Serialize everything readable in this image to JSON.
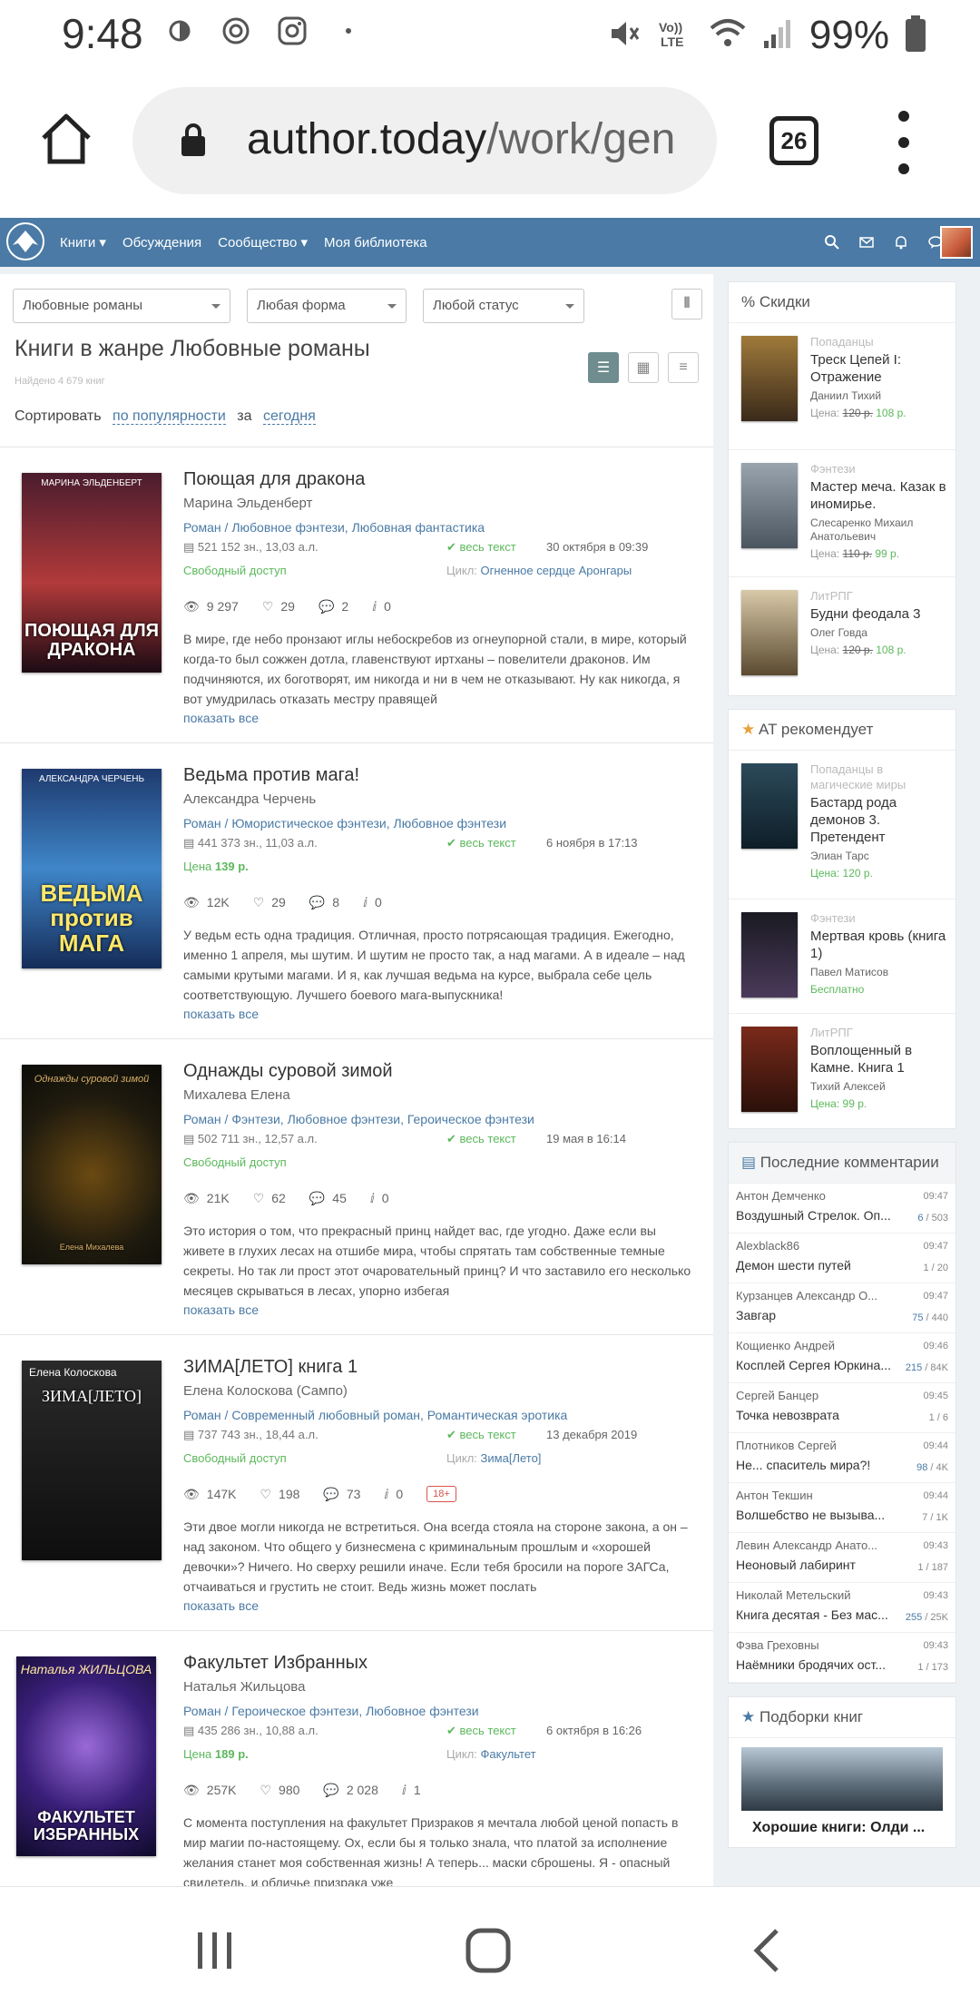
{
  "status": {
    "time": "9:48",
    "battery": "99%"
  },
  "browser": {
    "url_host": "author.today",
    "url_path": "/work/gen",
    "tab_count": "26"
  },
  "nav": {
    "links": [
      "Книги",
      "Обсуждения",
      "Сообщество",
      "Моя библиотека"
    ]
  },
  "filters": {
    "genre": "Любовные романы",
    "form": "Любая форма",
    "status": "Любой статус"
  },
  "page": {
    "title": "Книги в жанре Любовные романы",
    "found": "Найдено 4 679 книг",
    "sort_label": "Сортировать",
    "sort_value": "по популярности",
    "period_label": "за",
    "period_value": "сегодня"
  },
  "books": [
    {
      "title": "Поющая для дракона",
      "author": "Марина Эльденберт",
      "genres": "Роман / Любовное фэнтези, Любовная фантастика",
      "size": "521 152 зн., 13,03 а.л.",
      "text_status": "весь текст",
      "date": "30 октября в 09:39",
      "access": "Свободный доступ",
      "cycle_label": "Цикл:",
      "cycle": "Огненное сердце Аронгары",
      "views": "9 297",
      "likes": "29",
      "comments": "2",
      "awards": "0",
      "annotation": "В мире, где небо пронзают иглы небоскребов из огнеупорной стали, в мире, который когда-то был сожжен дотла, главенствуют иртханы – повелители драконов. Им подчиняются, их боготворят, им никогда и ни в чем не отказывают. Ну как никогда, я вот умудрилась отказать местру правящей",
      "more": "показать все",
      "cover_author": "МАРИНА ЭЛЬДЕНБЕРТ",
      "cover_title": "ПОЮЩАЯ ДЛЯ ДРАКОНА"
    },
    {
      "title": "Ведьма против мага!",
      "author": "Александра Черчень",
      "genres": "Роман / Юмористическое фэнтези, Любовное фэнтези",
      "size": "441 373 зн., 11,03 а.л.",
      "text_status": "весь текст",
      "date": "6 ноября в 17:13",
      "price_label": "Цена",
      "price": "139 р.",
      "views": "12K",
      "likes": "29",
      "comments": "8",
      "awards": "0",
      "annotation": "У ведьм есть одна традиция. Отличная, просто потрясающая традиция. Ежегодно, именно 1 апреля, мы шутим. И шутим не просто так, а над магами. А в идеале – над самыми крутыми магами. И я, как лучшая ведьма на курсе, выбрала себе цель соответствующую. Лучшего боевого мага-выпускника!",
      "more": "показать все",
      "cover_author": "АЛЕКСАНДРА ЧЕРЧЕНЬ",
      "cover_title": "ВЕДЬМА против МАГА"
    },
    {
      "title": "Однажды суровой зимой",
      "author": "Михалева Елена",
      "genres": "Роман / Фэнтези, Любовное фэнтези, Героическое фэнтези",
      "size": "502 711 зн., 12,57 а.л.",
      "text_status": "весь текст",
      "date": "19 мая в 16:14",
      "access": "Свободный доступ",
      "views": "21K",
      "likes": "62",
      "comments": "45",
      "awards": "0",
      "annotation": "Это история о том, что прекрасный принц найдет вас, где угодно. Даже если вы живете в глухих лесах на отшибе мира, чтобы спрятать там собственные темные секреты. Но так ли прост этот очаровательный принц? И что заставило его несколько месяцев скрываться в лесах, упорно избегая",
      "more": "показать все",
      "cover_author": "Однажды суровой зимой",
      "cover_title": "Елена Михалева"
    },
    {
      "title": "ЗИМА[ЛЕТО] книга 1",
      "author": "Елена Колоскова (Сампо)",
      "genres": "Роман / Современный любовный роман, Романтическая эротика",
      "size": "737 743 зн., 18,44 а.л.",
      "text_status": "весь текст",
      "date": "13 декабря 2019",
      "access": "Свободный доступ",
      "cycle_label": "Цикл:",
      "cycle": "Зима[Лето]",
      "views": "147K",
      "likes": "198",
      "comments": "73",
      "awards": "0",
      "age": "18+",
      "annotation": "Эти двое могли никогда не встретиться. Она всегда стояла на стороне закона, а он – над законом. Что общего у бизнесмена с криминальным прошлым и «хорошей девочки»? Ничего. Но сверху решили иначе. Если тебя бросили на пороге ЗАГСа, отчаиваться и грустить не стоит. Ведь жизнь может послать",
      "more": "показать все",
      "cover_author": "Елена Колоскова",
      "cover_title": "ЗИМА[ЛЕТО]"
    },
    {
      "title": "Факультет Избранных",
      "author": "Наталья Жильцова",
      "genres": "Роман / Героическое фэнтези, Любовное фэнтези",
      "size": "435 286 зн., 10,88 а.л.",
      "text_status": "весь текст",
      "date": "6 октября в 16:26",
      "price_label": "Цена",
      "price": "189 р.",
      "cycle_label": "Цикл:",
      "cycle": "Факультет",
      "views": "257K",
      "likes": "980",
      "comments": "2 028",
      "awards": "1",
      "annotation": "С момента поступления на факультет Призраков я мечтала любой ценой попасть в мир магии по-настоящему. Ох, если бы я только знала, что платой за исполнение желания станет моя собственная жизнь! А теперь... маски сброшены. Я - опасный свидетель, и обличье призрака уже",
      "more": "",
      "cover_author": "Наталья ЖИЛЬЦОВА",
      "cover_title": "ФАКУЛЬТЕТ ИЗБРАННЫХ"
    }
  ],
  "sidebar": {
    "discounts": {
      "header": "% Скидки",
      "items": [
        {
          "genre": "Попаданцы",
          "title": "Треск Цепей I: Отражение",
          "author": "Даниил Тихий",
          "price_label": "Цена:",
          "old": "120 р.",
          "new": "108 р."
        },
        {
          "genre": "Фэнтези",
          "title": "Мастер меча. Казак в иномирье.",
          "author": "Слесаренко Михаил Анатольевич",
          "price_label": "Цена:",
          "old": "110 р.",
          "new": "99 р."
        },
        {
          "genre": "ЛитРПГ",
          "title": "Будни феодала 3",
          "author": "Олег Говда",
          "price_label": "Цена:",
          "old": "120 р.",
          "new": "108 р."
        }
      ]
    },
    "recommends": {
      "header": "AT рекомендует",
      "items": [
        {
          "genre": "Попаданцы в магические миры",
          "title": "Бастард рода демонов 3. Претендент",
          "author": "Элиан Тарс",
          "price": "Цена: 120 р."
        },
        {
          "genre": "Фэнтези",
          "title": "Мертвая кровь (книга 1)",
          "author": "Павел Матисов",
          "price": "Бесплатно"
        },
        {
          "genre": "ЛитРПГ",
          "title": "Воплощенный в Камне. Книга 1",
          "author": "Тихий Алексей",
          "price": "Цена: 99 р."
        }
      ]
    },
    "comments": {
      "header": "Последние комментарии",
      "items": [
        {
          "name": "Антон Демченко",
          "time": "09:47",
          "topic": "Воздушный Стрелок. Оп...",
          "new": "6",
          "total": "/ 503"
        },
        {
          "name": "Alexblack86",
          "time": "09:47",
          "topic": "Демон шести путей",
          "new": "",
          "total": "1 / 20"
        },
        {
          "name": "Курзанцев Александр О...",
          "time": "09:47",
          "topic": "Завгар",
          "new": "75",
          "total": "/ 440"
        },
        {
          "name": "Кощиенко Андрей",
          "time": "09:46",
          "topic": "Косплей Сергея Юркина...",
          "new": "215",
          "total": "/ 84K"
        },
        {
          "name": "Сергей Банцер",
          "time": "09:45",
          "topic": "Точка невозврата",
          "new": "",
          "total": "1 / 6"
        },
        {
          "name": "Плотников Сергей",
          "time": "09:44",
          "topic": "Не... спаситель мира?!",
          "new": "98",
          "total": "/ 4K"
        },
        {
          "name": "Антон Текшин",
          "time": "09:44",
          "topic": "Волшебство не вызыва...",
          "new": "",
          "total": "7 / 1K"
        },
        {
          "name": "Левин Александр Анато...",
          "time": "09:43",
          "topic": "Неоновый лабиринт",
          "new": "",
          "total": "1 / 187"
        },
        {
          "name": "Николай Метельский",
          "time": "09:43",
          "topic": "Книга десятая - Без мас...",
          "new": "255",
          "total": "/ 25K"
        },
        {
          "name": "Фэва Греховны",
          "time": "09:43",
          "topic": "Наёмники бродячих ост...",
          "new": "",
          "total": "1 / 173"
        }
      ]
    },
    "collections": {
      "header": "Подборки книг",
      "title": "Хорошие книги: Олди ..."
    }
  },
  "colors": {
    "nav": "#4a7aa5",
    "link": "#4a7aa5",
    "green": "#5cb85c"
  }
}
